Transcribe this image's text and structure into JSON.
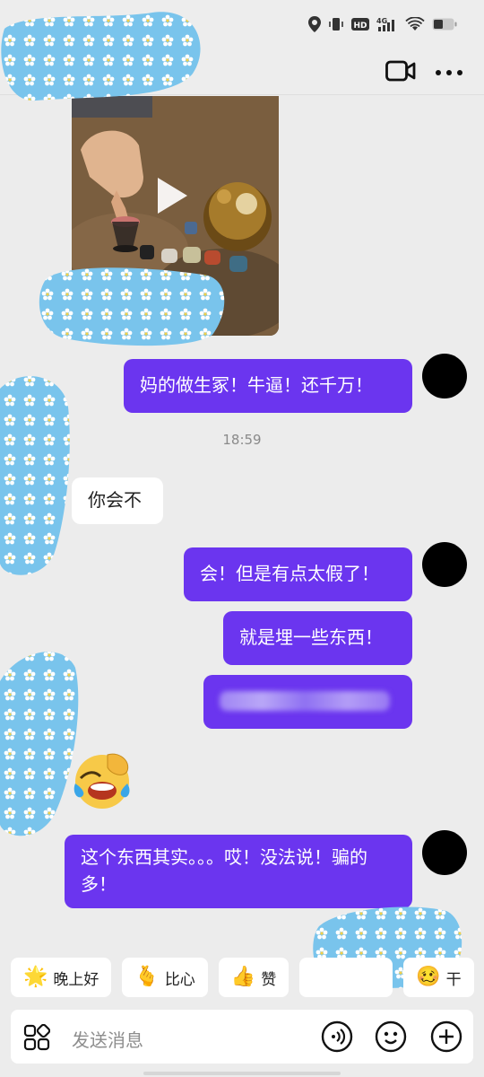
{
  "status_bar": {
    "icons": [
      "location-icon",
      "vibrate-icon",
      "hd-icon",
      "4g-icon",
      "wifi-icon",
      "battery-icon"
    ],
    "hd_label": "HD",
    "net_label": "4G"
  },
  "header": {
    "actions": [
      "video-call-icon",
      "more-icon"
    ]
  },
  "messages": [
    {
      "type": "video",
      "from": "other"
    },
    {
      "type": "text",
      "from": "me",
      "text": "妈的做生冢！牛逼！还千万！"
    },
    {
      "type": "timestamp",
      "text": "18:59"
    },
    {
      "type": "text",
      "from": "other",
      "text": "你会不"
    },
    {
      "type": "text",
      "from": "me",
      "text": "会！但是有点太假了！"
    },
    {
      "type": "text",
      "from": "me",
      "text": "就是埋一些东西！"
    },
    {
      "type": "text",
      "from": "me",
      "text": "",
      "blurred": true
    },
    {
      "type": "emoji",
      "from": "other",
      "icon": "laughing-crying-emoji"
    },
    {
      "type": "text",
      "from": "me",
      "text": "这个东西其实。。。哎！没法说！骗的多！"
    }
  ],
  "quick_replies": [
    {
      "label": "晚上好",
      "icon": "star-face-emoji",
      "glyph": "🌟"
    },
    {
      "label": "比心",
      "icon": "heart-hands-emoji",
      "glyph": "🫰"
    },
    {
      "label": "赞",
      "icon": "thumbs-up-emoji",
      "glyph": "👍"
    },
    {
      "label": "",
      "icon": "partial-emoji",
      "glyph": ""
    },
    {
      "label": "干",
      "icon": "cheers-emoji",
      "glyph": "🥴"
    }
  ],
  "input": {
    "placeholder": "发送消息"
  },
  "colors": {
    "my_bubble": "#6b35ef",
    "background": "#ececec",
    "blob_blue": "#79c4ec"
  }
}
